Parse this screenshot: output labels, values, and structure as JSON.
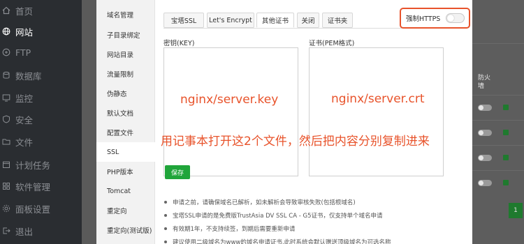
{
  "sidebar": {
    "items": [
      {
        "label": "首页",
        "icon": "home-icon"
      },
      {
        "label": "网站",
        "icon": "globe-icon"
      },
      {
        "label": "FTP",
        "icon": "ftp-icon"
      },
      {
        "label": "数据库",
        "icon": "database-icon"
      },
      {
        "label": "监控",
        "icon": "monitor-icon"
      },
      {
        "label": "安全",
        "icon": "shield-icon"
      },
      {
        "label": "文件",
        "icon": "folder-icon"
      },
      {
        "label": "计划任务",
        "icon": "calendar-icon"
      },
      {
        "label": "软件管理",
        "icon": "grid-icon"
      },
      {
        "label": "面板设置",
        "icon": "gear-icon"
      },
      {
        "label": "退出",
        "icon": "logout-icon"
      }
    ],
    "active_index": 1
  },
  "modal": {
    "nav": [
      "域名管理",
      "子目录绑定",
      "网站目录",
      "流量限制",
      "伪静态",
      "默认文档",
      "配置文件",
      "SSL",
      "PHP版本",
      "Tomcat",
      "重定向",
      "重定向(测试版)"
    ],
    "active_nav": "SSL",
    "tabs": [
      "宝塔SSL",
      "Let's Encrypt",
      "其他证书",
      "关闭",
      "证书夹"
    ],
    "active_tab": "其他证书",
    "force_https_label": "强制HTTPS",
    "force_https_on": false,
    "key_label": "密钥(KEY)",
    "cert_label": "证书(PEM格式)",
    "key_annotation": "nginx/server.key",
    "cert_annotation": "nginx/server.crt",
    "overlay_instruction": "用记事本打开这2个文件，然后把内容分别复制进来",
    "save_label": "保存",
    "tips": [
      "申请之前，请确保域名已解析，如未解析会导致审核失败(包括根域名)",
      "宝塔SSL申请的是免费版TrustAsia DV SSL CA - G5证书，仅支持单个域名申请",
      "有效期1年，不支持续签，到期后需要重新申请",
      "建议使用二级域名为www的域名申请证书,此时系统会默认赠送顶级域名为可选名称"
    ]
  },
  "background": {
    "column_label": "防火墙",
    "pagination_current": "1"
  },
  "colors": {
    "accent_green": "#20a53a",
    "highlight_red": "#e8532b",
    "sidebar_bg": "#2a2d31"
  }
}
